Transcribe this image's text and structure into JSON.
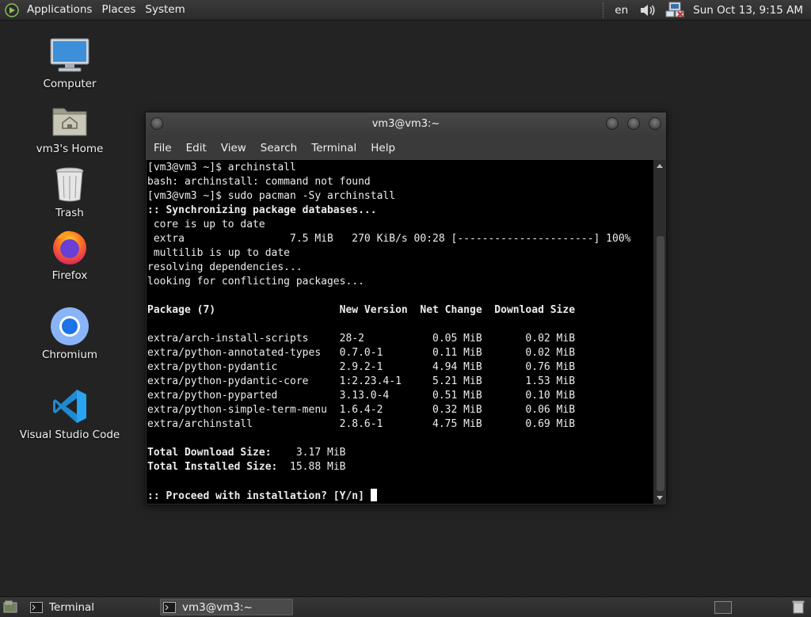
{
  "top_panel": {
    "menus": [
      "Applications",
      "Places",
      "System"
    ],
    "language": "en",
    "clock": "Sun Oct 13,  9:15 AM"
  },
  "desktop_icons": [
    {
      "label": "Computer",
      "icon": "computer-icon"
    },
    {
      "label": "vm3's Home",
      "icon": "home-folder-icon"
    },
    {
      "label": "Trash",
      "icon": "trash-icon"
    },
    {
      "label": "Firefox",
      "icon": "firefox-icon"
    },
    {
      "label": "Chromium",
      "icon": "chromium-icon"
    },
    {
      "label": "Visual Studio Code",
      "icon": "vscode-icon"
    }
  ],
  "terminal": {
    "title": "vm3@vm3:~",
    "menu": [
      "File",
      "Edit",
      "View",
      "Search",
      "Terminal",
      "Help"
    ],
    "lines": [
      {
        "text": "[vm3@vm3 ~]$ archinstall",
        "bold": false
      },
      {
        "text": "bash: archinstall: command not found",
        "bold": false
      },
      {
        "text": "[vm3@vm3 ~]$ sudo pacman -Sy archinstall",
        "bold": false
      },
      {
        "text": ":: Synchronizing package databases...",
        "bold": true
      },
      {
        "text": " core is up to date",
        "bold": false
      },
      {
        "text": " extra                 7.5 MiB   270 KiB/s 00:28 [----------------------] 100%",
        "bold": false
      },
      {
        "text": " multilib is up to date",
        "bold": false
      },
      {
        "text": "resolving dependencies...",
        "bold": false
      },
      {
        "text": "looking for conflicting packages...",
        "bold": false
      },
      {
        "text": "",
        "bold": false
      },
      {
        "text": "Package (7)                    New Version  Net Change  Download Size",
        "bold": true
      },
      {
        "text": "",
        "bold": false
      },
      {
        "text": "extra/arch-install-scripts     28-2           0.05 MiB       0.02 MiB",
        "bold": false
      },
      {
        "text": "extra/python-annotated-types   0.7.0-1        0.11 MiB       0.02 MiB",
        "bold": false
      },
      {
        "text": "extra/python-pydantic          2.9.2-1        4.94 MiB       0.76 MiB",
        "bold": false
      },
      {
        "text": "extra/python-pydantic-core     1:2.23.4-1     5.21 MiB       1.53 MiB",
        "bold": false
      },
      {
        "text": "extra/python-pyparted          3.13.0-4       0.51 MiB       0.10 MiB",
        "bold": false
      },
      {
        "text": "extra/python-simple-term-menu  1.6.4-2        0.32 MiB       0.06 MiB",
        "bold": false
      },
      {
        "text": "extra/archinstall              2.8.6-1        4.75 MiB       0.69 MiB",
        "bold": false
      },
      {
        "text": "",
        "bold": false
      },
      {
        "text": "Total Download Size:    3.17 MiB",
        "bold": "label"
      },
      {
        "text": "Total Installed Size:  15.88 MiB",
        "bold": "label"
      },
      {
        "text": "",
        "bold": false
      },
      {
        "text": ":: Proceed with installation? [Y/n] ",
        "bold": true,
        "cursor": true
      }
    ]
  },
  "taskbar": {
    "tasks": [
      {
        "label": "Terminal",
        "active": false
      },
      {
        "label": "vm3@vm3:~",
        "active": true
      }
    ]
  }
}
